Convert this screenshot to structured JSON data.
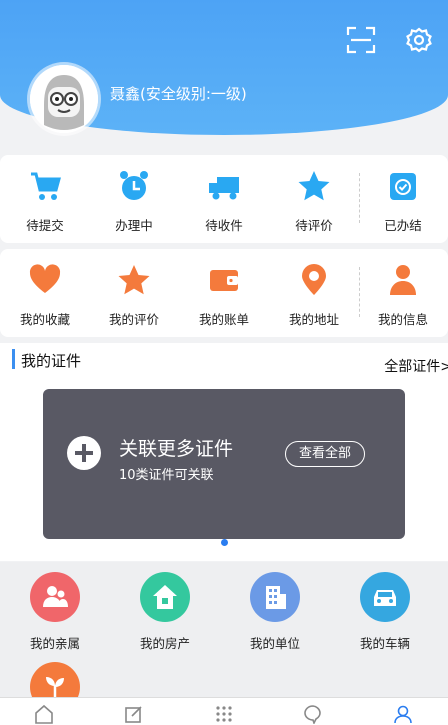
{
  "header": {
    "username": "聂鑫(安全级别:一级)",
    "scan_icon": "scan-icon",
    "settings_icon": "gear-icon"
  },
  "row1": [
    {
      "label": "待提交",
      "icon": "cart-icon",
      "color": "#29a8f2"
    },
    {
      "label": "办理中",
      "icon": "alarm-clock-icon",
      "color": "#29a8f2"
    },
    {
      "label": "待收件",
      "icon": "truck-icon",
      "color": "#29a8f2"
    },
    {
      "label": "待评价",
      "icon": "star-icon",
      "color": "#29a8f2"
    },
    {
      "label": "已办结",
      "icon": "calendar-check-icon",
      "color": "#29a8f2"
    }
  ],
  "row2": [
    {
      "label": "我的收藏",
      "icon": "heart-icon",
      "color": "#f47a3c"
    },
    {
      "label": "我的评价",
      "icon": "star-icon",
      "color": "#f47a3c"
    },
    {
      "label": "我的账单",
      "icon": "wallet-icon",
      "color": "#f47a3c"
    },
    {
      "label": "我的地址",
      "icon": "location-pin-icon",
      "color": "#f47a3c"
    },
    {
      "label": "我的信息",
      "icon": "person-icon",
      "color": "#f47a3c"
    }
  ],
  "certificates": {
    "title": "我的证件",
    "all_link": "全部证件>",
    "card_title": "关联更多证件",
    "card_subtitle": "10类证件可关联",
    "card_button": "查看全部"
  },
  "services": [
    {
      "label": "我的亲属",
      "icon": "family-icon",
      "color": "#f0666a"
    },
    {
      "label": "我的房产",
      "icon": "house-icon",
      "color": "#34c89e"
    },
    {
      "label": "我的单位",
      "icon": "building-icon",
      "color": "#6b9ae6"
    },
    {
      "label": "我的车辆",
      "icon": "car-icon",
      "color": "#35a7e0"
    },
    {
      "label": "",
      "icon": "plant-icon",
      "color": "#f47a3c"
    }
  ],
  "tabbar": [
    "home-icon",
    "edit-icon",
    "apps-icon",
    "chat-icon",
    "profile-icon"
  ]
}
